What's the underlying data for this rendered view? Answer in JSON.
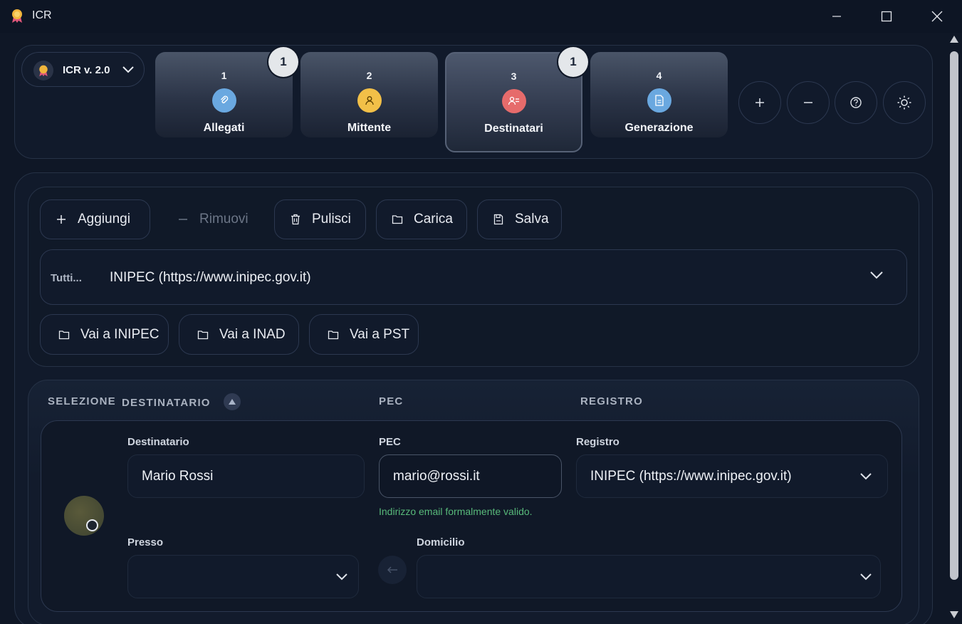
{
  "window": {
    "title": "ICR",
    "controls": [
      "minimize",
      "maximize",
      "close"
    ]
  },
  "version": {
    "label": "ICR v. 2.0"
  },
  "steps": [
    {
      "number": "1",
      "label": "Allegati",
      "icon": "paperclip-icon",
      "color": "#6aa8e0",
      "badge": "1"
    },
    {
      "number": "2",
      "label": "Mittente",
      "icon": "user-icon",
      "color": "#f2c048"
    },
    {
      "number": "3",
      "label": "Destinatari",
      "icon": "users-icon",
      "color": "#e66b6b",
      "badge": "1",
      "active": true
    },
    {
      "number": "4",
      "label": "Generazione",
      "icon": "document-icon",
      "color": "#6aa8e0"
    }
  ],
  "header_actions": [
    "plus-icon",
    "minus-icon",
    "help-icon",
    "theme-icon"
  ],
  "toolbar": {
    "add": "Aggiungi",
    "remove": "Rimuovi",
    "clear": "Pulisci",
    "load": "Carica",
    "save": "Salva"
  },
  "registry_filter": {
    "prefix": "Tutti...",
    "value": "INIPEC (https://www.inipec.gov.it)"
  },
  "go_buttons": {
    "inipec": "Vai a INIPEC",
    "inad": "Vai a INAD",
    "pst": "Vai a PST"
  },
  "table": {
    "headers": {
      "selection": "SELEZIONE",
      "recipient": "DESTINATARIO",
      "pec": "PEC",
      "registry": "REGISTRO"
    }
  },
  "row": {
    "labels": {
      "recipient": "Destinatario",
      "pec": "PEC",
      "registry": "Registro",
      "presso": "Presso",
      "domicile": "Domicilio"
    },
    "values": {
      "recipient": "Mario Rossi",
      "pec": "mario@rossi.it",
      "registry": "INIPEC (https://www.inipec.gov.it)",
      "presso": "",
      "domicile": ""
    },
    "pec_hint": "Indirizzo email formalmente valido.",
    "hint_color": "#58b97a"
  }
}
